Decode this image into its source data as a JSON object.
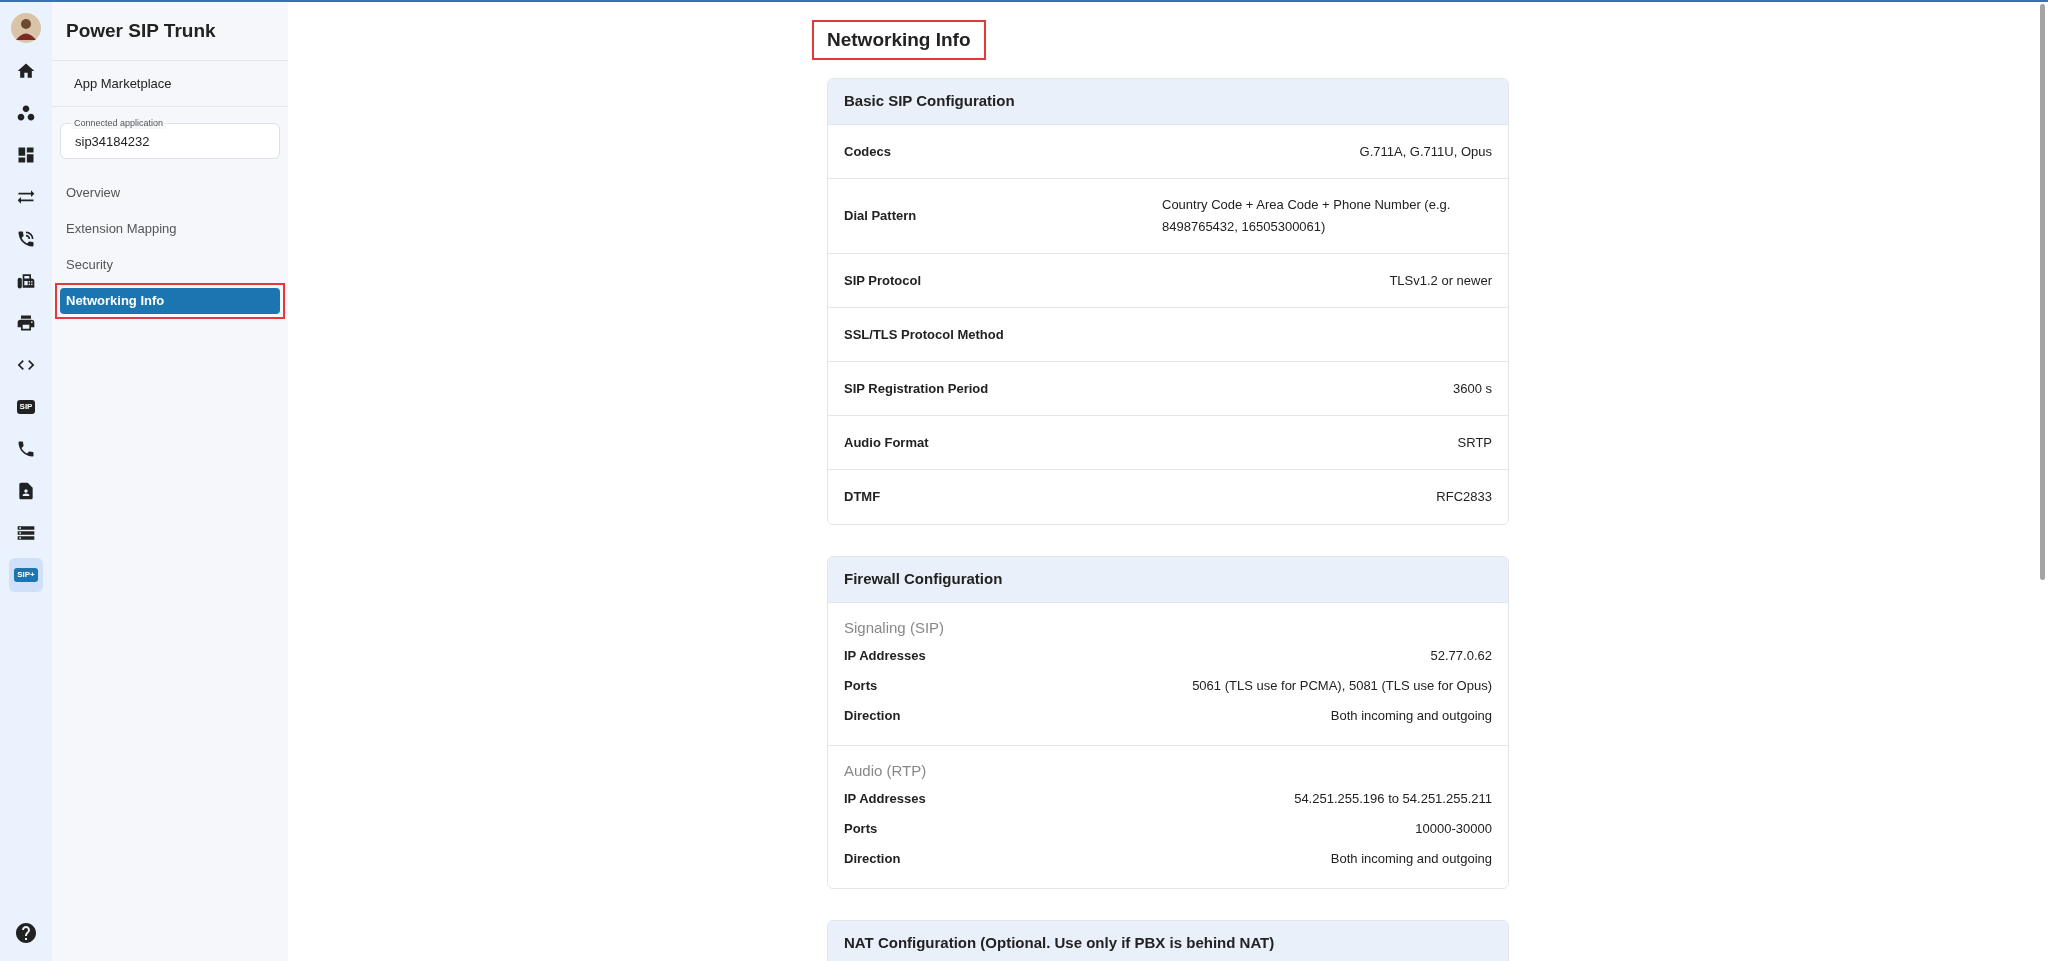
{
  "rail": {
    "items": [
      {
        "kind": "avatar"
      },
      {
        "kind": "home",
        "selected": false
      },
      {
        "kind": "circles",
        "selected": false
      },
      {
        "kind": "dashboard",
        "selected": false
      },
      {
        "kind": "arrows",
        "selected": false
      },
      {
        "kind": "phone-dots",
        "selected": false
      },
      {
        "kind": "fax",
        "selected": false
      },
      {
        "kind": "printer",
        "selected": false
      },
      {
        "kind": "code",
        "selected": false
      },
      {
        "kind": "badge",
        "label": "SIP",
        "selected": false
      },
      {
        "kind": "phone",
        "selected": false
      },
      {
        "kind": "contact",
        "selected": false
      },
      {
        "kind": "server",
        "selected": false
      },
      {
        "kind": "badge",
        "label": "SIP+",
        "selected": true
      }
    ],
    "help": {
      "kind": "help"
    }
  },
  "sidebar": {
    "title": "Power SIP Trunk",
    "marketplace": "App Marketplace",
    "connected_application": {
      "label": "Connected application",
      "value": "sip34184232"
    },
    "items": [
      {
        "label": "Overview",
        "selected": false,
        "highlighted": false
      },
      {
        "label": "Extension Mapping",
        "selected": false,
        "highlighted": false
      },
      {
        "label": "Security",
        "selected": false,
        "highlighted": false
      },
      {
        "label": "Networking Info",
        "selected": true,
        "highlighted": true
      }
    ]
  },
  "main": {
    "heading": {
      "text": "Networking Info",
      "highlighted": true
    },
    "cards": [
      {
        "title": "Basic SIP Configuration",
        "kind": "table",
        "rows": [
          {
            "label": "Codecs",
            "value": "G.711A, G.711U, Opus"
          },
          {
            "label": "Dial Pattern",
            "value": "Country Code + Area Code + Phone Number (e.g. 8498765432, 16505300061)"
          },
          {
            "label": "SIP Protocol",
            "value": "TLSv1.2 or newer"
          },
          {
            "label": "SSL/TLS Protocol Method"
          },
          {
            "label": "SIP Registration Period",
            "value": "3600 s"
          },
          {
            "label": "Audio Format",
            "value": "SRTP"
          },
          {
            "label": "DTMF",
            "value": "RFC2833"
          }
        ]
      },
      {
        "title": "Firewall Configuration",
        "kind": "groups",
        "groups": [
          {
            "title": "Signaling (SIP)",
            "rows": [
              {
                "label": "IP Addresses",
                "value": "52.77.0.62"
              },
              {
                "label": "Ports",
                "value": "5061 (TLS use for PCMA), 5081 (TLS use for Opus)"
              },
              {
                "label": "Direction",
                "value": "Both incoming and outgoing"
              }
            ]
          },
          {
            "title": "Audio (RTP)",
            "rows": [
              {
                "label": "IP Addresses",
                "value": "54.251.255.196 to 54.251.255.211"
              },
              {
                "label": "Ports",
                "value": "10000-30000"
              },
              {
                "label": "Direction",
                "value": "Both incoming and outgoing"
              }
            ]
          }
        ]
      },
      {
        "title": "NAT Configuration (Optional. Use only if PBX is behind NAT)"
      }
    ]
  }
}
